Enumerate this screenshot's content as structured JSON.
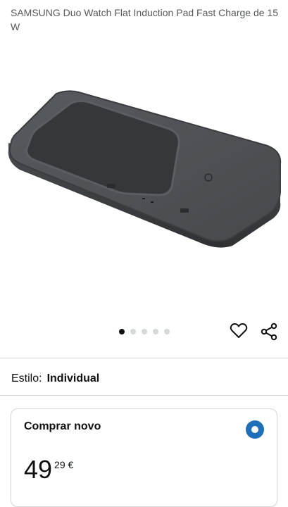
{
  "product": {
    "title": "SAMSUNG Duo Watch Flat Induction Pad Fast Charge de 15 W"
  },
  "gallery": {
    "image_count": 5,
    "active_index": 0,
    "icons": [
      "heart-icon",
      "share-icon"
    ]
  },
  "style": {
    "label": "Estilo:",
    "value": "Individual"
  },
  "buy_box": {
    "title": "Comprar novo",
    "price_whole": "49",
    "price_fraction": "29 €",
    "selected": true
  },
  "colors": {
    "accent": "#1e6fb8",
    "text": "#0f1111",
    "muted": "#565959",
    "divider": "#d5d9d9"
  }
}
